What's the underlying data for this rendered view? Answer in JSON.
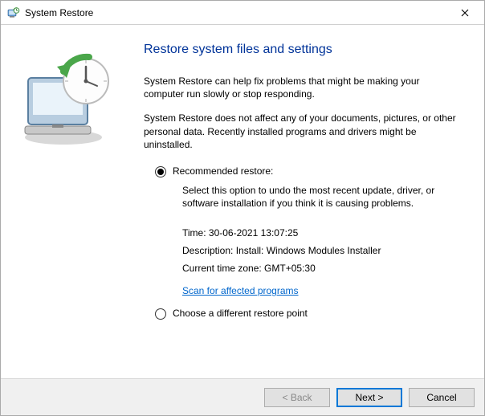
{
  "window": {
    "title": "System Restore"
  },
  "main": {
    "heading": "Restore system files and settings",
    "para1": "System Restore can help fix problems that might be making your computer run slowly or stop responding.",
    "para2": "System Restore does not affect any of your documents, pictures, or other personal data. Recently installed programs and drivers might be uninstalled."
  },
  "options": {
    "recommended": {
      "label": "Recommended restore:",
      "description": "Select this option to undo the most recent update, driver, or software installation if you think it is causing problems.",
      "time_label": "Time: ",
      "time_value": "30-06-2021 13:07:25",
      "desc_label": "Description: ",
      "desc_value": "Install: Windows Modules Installer",
      "tz_label": "Current time zone: ",
      "tz_value": "GMT+05:30",
      "scan_link": "Scan for affected programs"
    },
    "different": {
      "label": "Choose a different restore point"
    },
    "selected": "recommended"
  },
  "footer": {
    "back": "< Back",
    "next": "Next >",
    "cancel": "Cancel"
  }
}
